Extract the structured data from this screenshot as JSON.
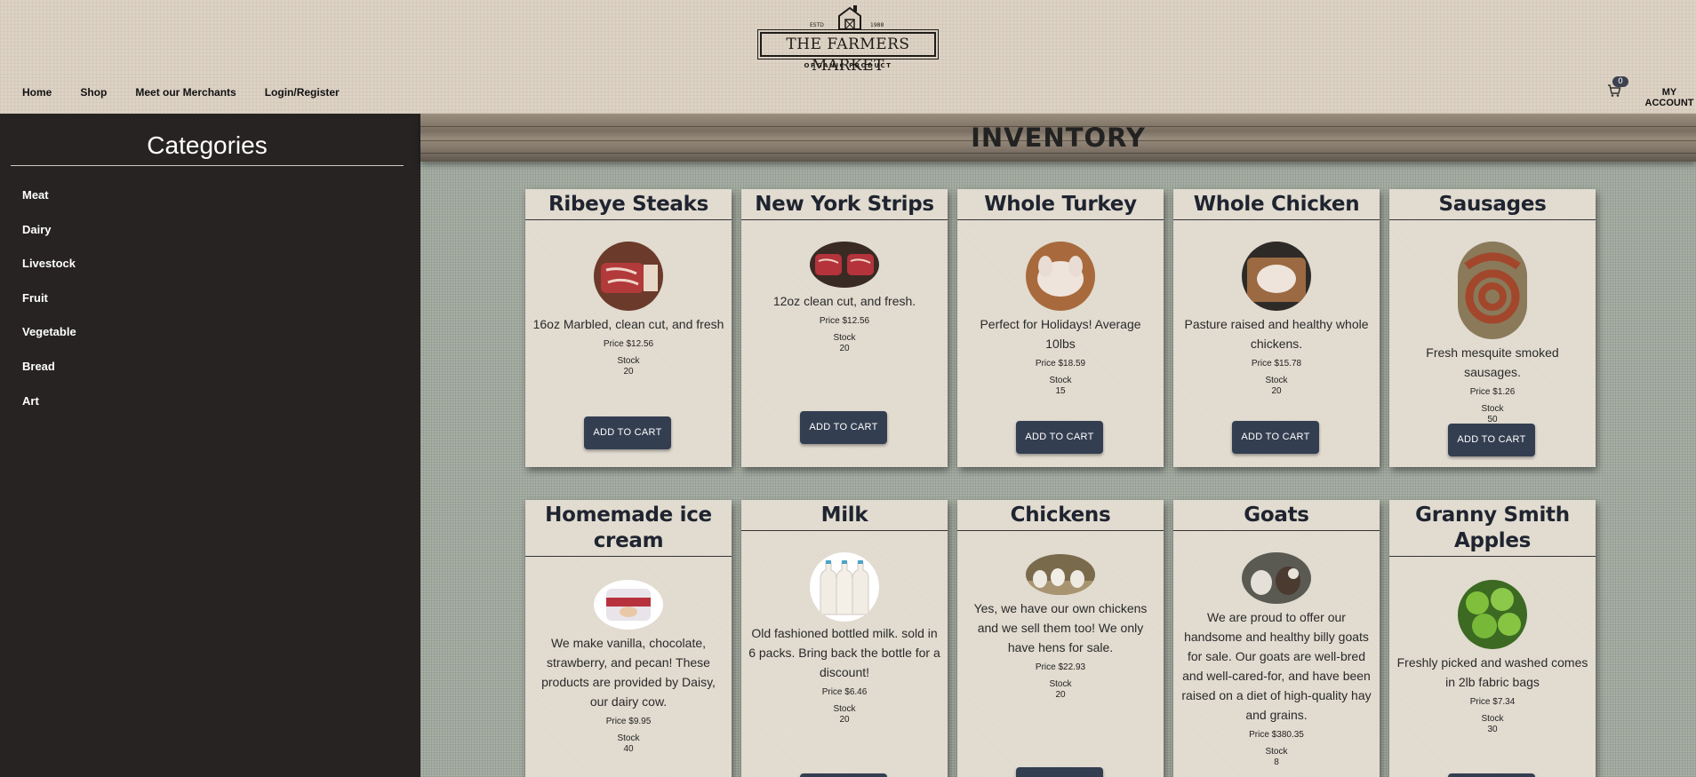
{
  "header": {
    "logo": {
      "estd": "ESTD",
      "year": "1988",
      "name": "THE FARMERS MARKET",
      "sub": "ORGANIC PRODUCT"
    },
    "nav": [
      "Home",
      "Shop",
      "Meet our Merchants",
      "Login/Register"
    ],
    "cart_count": "0",
    "account_line1": "MY",
    "account_line2": "ACCOUNT"
  },
  "sidebar": {
    "title": "Categories",
    "items": [
      "Meat",
      "Dairy",
      "Livestock",
      "Fruit",
      "Vegetable",
      "Bread",
      "Art"
    ]
  },
  "main": {
    "title": "INVENTORY",
    "add_to_cart_label": "ADD TO CART",
    "stock_label": "Stock",
    "products": [
      {
        "name": "Ribeye Steaks",
        "desc": "16oz Marbled, clean cut, and fresh",
        "price": "Price $12.56",
        "stock": "20",
        "image": "steak-photo"
      },
      {
        "name": "New York Strips",
        "desc": "12oz clean cut, and fresh.",
        "price": "Price $12.56",
        "stock": "20",
        "image": "steak-photo"
      },
      {
        "name": "Whole Turkey",
        "desc": "Perfect for Holidays! Average 10lbs",
        "price": "Price $18.59",
        "stock": "15",
        "image": "turkey-photo"
      },
      {
        "name": "Whole Chicken",
        "desc": "Pasture raised and healthy whole chickens.",
        "price": "Price $15.78",
        "stock": "20",
        "image": "chicken-photo"
      },
      {
        "name": "Sausages",
        "desc": "Fresh mesquite smoked sausages.",
        "price": "Price $1.26",
        "stock": "50",
        "image": "sausage-photo"
      },
      {
        "name": "Homemade ice cream",
        "desc": "We make vanilla, chocolate, strawberry, and pecan! These products are provided by Daisy, our dairy cow.",
        "price": "Price $9.95",
        "stock": "40",
        "image": "ice-cream-photo"
      },
      {
        "name": "Milk",
        "desc": "Old fashioned bottled milk. sold in 6 packs. Bring back the bottle for a discount!",
        "price": "Price $6.46",
        "stock": "20",
        "image": "milk-photo"
      },
      {
        "name": "Chickens",
        "desc": "Yes, we have our own chickens and we sell them too! We only have hens for sale.",
        "price": "Price $22.93",
        "stock": "20",
        "image": "hens-photo"
      },
      {
        "name": "Goats",
        "desc": "We are proud to offer our handsome and healthy billy goats for sale. Our goats are well-bred and well-cared-for, and have been raised on a diet of high-quality hay and grains.",
        "price": "Price $380.35",
        "stock": "8",
        "image": "goats-photo"
      },
      {
        "name": "Granny Smith Apples",
        "desc": "Freshly picked and washed comes in 2lb fabric bags",
        "price": "Price $7.34",
        "stock": "30",
        "image": "apples-photo"
      }
    ]
  },
  "colors": {
    "sidebar_bg": "#262322",
    "button_bg": "#333e51",
    "card_bg": "#e3ddd2"
  }
}
